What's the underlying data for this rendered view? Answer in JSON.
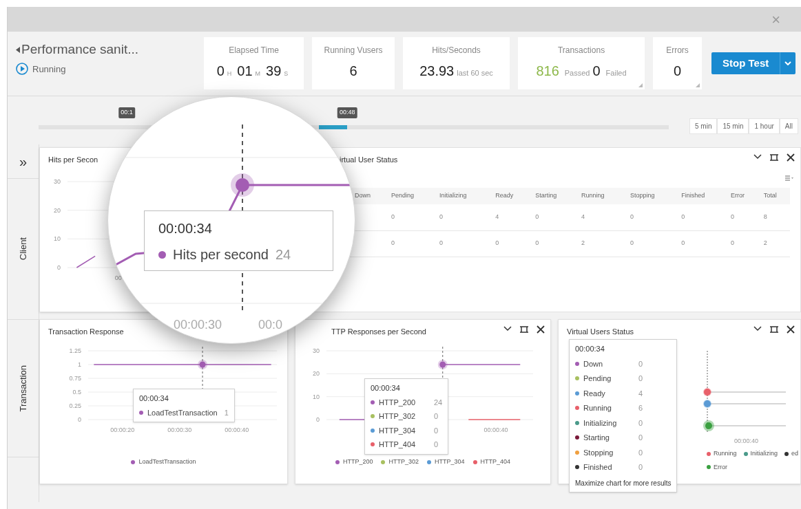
{
  "window": {
    "close": "×"
  },
  "test": {
    "title": "Performance sanit...",
    "status": "Running"
  },
  "kpis": [
    {
      "kind": "time",
      "label": "Elapsed Time",
      "parts": [
        {
          "value": "0",
          "unit": "H"
        },
        {
          "value": "01",
          "unit": "M"
        },
        {
          "value": "39",
          "unit": "S"
        }
      ]
    },
    {
      "kind": "value",
      "label": "Running Vusers",
      "value": "6"
    },
    {
      "kind": "value",
      "label": "Hits/Seconds",
      "value": "23.93",
      "note": "last 60 sec"
    },
    {
      "kind": "transactions",
      "label": "Transactions",
      "passed": "816",
      "passed_label": "Passed",
      "failed": "0",
      "failed_label": "Failed"
    },
    {
      "kind": "value",
      "label": "Errors",
      "value": "0"
    }
  ],
  "stop_button": {
    "label": "Stop Test"
  },
  "timeline": {
    "markers": [
      "00:1",
      "00:48"
    ],
    "level": 0.49,
    "ranges": [
      "5 min",
      "15 min",
      "1 hour",
      "All"
    ]
  },
  "sidebar": {
    "toggle": "»",
    "sections": [
      "Client",
      "Transaction"
    ]
  },
  "hits_panel": {
    "title": "Hits per Secon",
    "chart_data": {
      "type": "line",
      "grid": true,
      "ylim": [
        0,
        30
      ],
      "yticks": [
        0,
        10,
        20,
        30
      ],
      "annotations": [
        {
          "text": "00"
        }
      ],
      "series": [
        {
          "name": "Hits per second",
          "color": "#a35db3",
          "values": [
            0,
            4,
            null,
            null,
            null,
            null,
            null,
            null,
            null,
            null,
            null,
            null
          ]
        }
      ]
    }
  },
  "vus_table": {
    "title": "irtual User Status",
    "columns": [
      "Down",
      "Pending",
      "Initializing",
      "Ready",
      "Starting",
      "Running",
      "Stopping",
      "Finished",
      "Error",
      "Total"
    ],
    "rows": [
      {
        "cells": [
          "",
          "0",
          "0",
          "4",
          "0",
          "4",
          "0",
          "0",
          "0",
          "8"
        ]
      },
      {
        "cells": [
          "",
          "0",
          "0",
          "0",
          "0",
          "2",
          "0",
          "0",
          "0",
          "2"
        ]
      }
    ]
  },
  "magnifier": {
    "tooltip": {
      "time": "00:00:34",
      "value": "24"
    },
    "xlabels": [
      "00:00:30",
      "00:0"
    ]
  },
  "transaction_panel": {
    "title": "Transaction Response",
    "chart_data": {
      "type": "line",
      "grid": true,
      "x": [
        15,
        20,
        25,
        30,
        34,
        40,
        46
      ],
      "xlim": [
        14,
        47
      ],
      "ylim": [
        0,
        1.25
      ],
      "yticks": [
        0,
        0.25,
        0.5,
        0.75,
        1,
        1.25
      ],
      "xticks": [
        {
          "value": 20,
          "label": "00:00:20"
        },
        {
          "value": 30,
          "label": "00:00:30"
        },
        {
          "value": 40,
          "label": "00:00:40"
        }
      ],
      "series": [
        {
          "name": "LoadTestTransaction",
          "color": "#a35db3",
          "values": [
            1,
            1,
            1,
            1,
            1,
            1,
            1
          ]
        }
      ],
      "ref_lines": [
        {
          "axis": "x",
          "value": 34
        }
      ]
    },
    "tooltip": {
      "time": "00:00:34",
      "items": [
        {
          "name": "LoadTestTransaction",
          "value": "1",
          "color": "#a35db3"
        }
      ]
    }
  },
  "http_panel": {
    "title": "TTP Responses per Second",
    "chart_data": {
      "type": "line",
      "grid": true,
      "ylim": [
        0,
        30
      ],
      "yticks": [
        0,
        10,
        20,
        30
      ],
      "annotations": [
        {
          "text": "00:00:40"
        }
      ],
      "series": [
        {
          "name": "HTTP_200",
          "color": "#a35db3",
          "values": [
            0,
            0,
            null,
            null,
            24,
            24,
            24,
            24
          ]
        },
        {
          "name": "HTTP_302",
          "color": "#a8c060",
          "values": [
            null,
            null,
            null,
            null,
            null,
            null,
            null,
            null
          ]
        },
        {
          "name": "HTTP_304",
          "color": "#5b9bd5",
          "values": [
            null,
            null,
            null,
            null,
            null,
            null,
            null,
            null
          ]
        },
        {
          "name": "HTTP_404",
          "color": "#e8606a",
          "values": [
            null,
            null,
            null,
            null,
            null,
            0,
            0,
            0
          ]
        }
      ]
    },
    "tooltip": {
      "time": "00:00:34",
      "items": [
        {
          "name": "HTTP_200",
          "value": "24",
          "color": "#a35db3"
        },
        {
          "name": "HTTP_302",
          "value": "0",
          "color": "#a8c060"
        },
        {
          "name": "HTTP_304",
          "value": "0",
          "color": "#5b9bd5"
        },
        {
          "name": "HTTP_404",
          "value": "0",
          "color": "#e8606a"
        }
      ]
    }
  },
  "vus_panel": {
    "title": "Virtual Users Status",
    "xlabel": "00:00:40",
    "legend": [
      {
        "name": "Running",
        "color": "#e8606a"
      },
      {
        "name": "Initializing",
        "color": "#4a9a8a"
      },
      {
        "name": "ed",
        "color": "#333333"
      },
      {
        "name": "Error",
        "color": "#3aa040"
      }
    ],
    "tooltip": {
      "time": "00:00:34",
      "items": [
        {
          "name": "Down",
          "value": "0",
          "color": "#a35db3"
        },
        {
          "name": "Pending",
          "value": "0",
          "color": "#a8c060"
        },
        {
          "name": "Ready",
          "value": "4",
          "color": "#5b9bd5"
        },
        {
          "name": "Running",
          "value": "6",
          "color": "#e8606a"
        },
        {
          "name": "Initializing",
          "value": "0",
          "color": "#4a9a8a"
        },
        {
          "name": "Starting",
          "value": "0",
          "color": "#7a1a3a"
        },
        {
          "name": "Stopping",
          "value": "0",
          "color": "#f0a040"
        },
        {
          "name": "Finished",
          "value": "0",
          "color": "#333333"
        }
      ],
      "footer": "Maximize chart for more results"
    }
  }
}
